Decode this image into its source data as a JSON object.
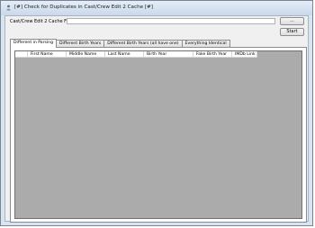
{
  "window": {
    "title": "[#] Check for Duplicates in Cast/Crew Edit 2 Cache [#]"
  },
  "form": {
    "cache_file_label": "Cast/Crew Edit 2 Cache File:",
    "cache_file_value": "",
    "browse_label": "...",
    "start_label": "Start"
  },
  "tabs": [
    {
      "label": "Different in Parsing",
      "active": true
    },
    {
      "label": "Different Birth Years",
      "active": false
    },
    {
      "label": "Different Birth Years (all have one)",
      "active": false
    },
    {
      "label": "Everything Identical",
      "active": false
    }
  ],
  "grid": {
    "columns": [
      "First Name",
      "Middle Name",
      "Last Name",
      "Birth Year",
      "Fake Birth Year",
      "IMDb Link"
    ],
    "rows": []
  }
}
